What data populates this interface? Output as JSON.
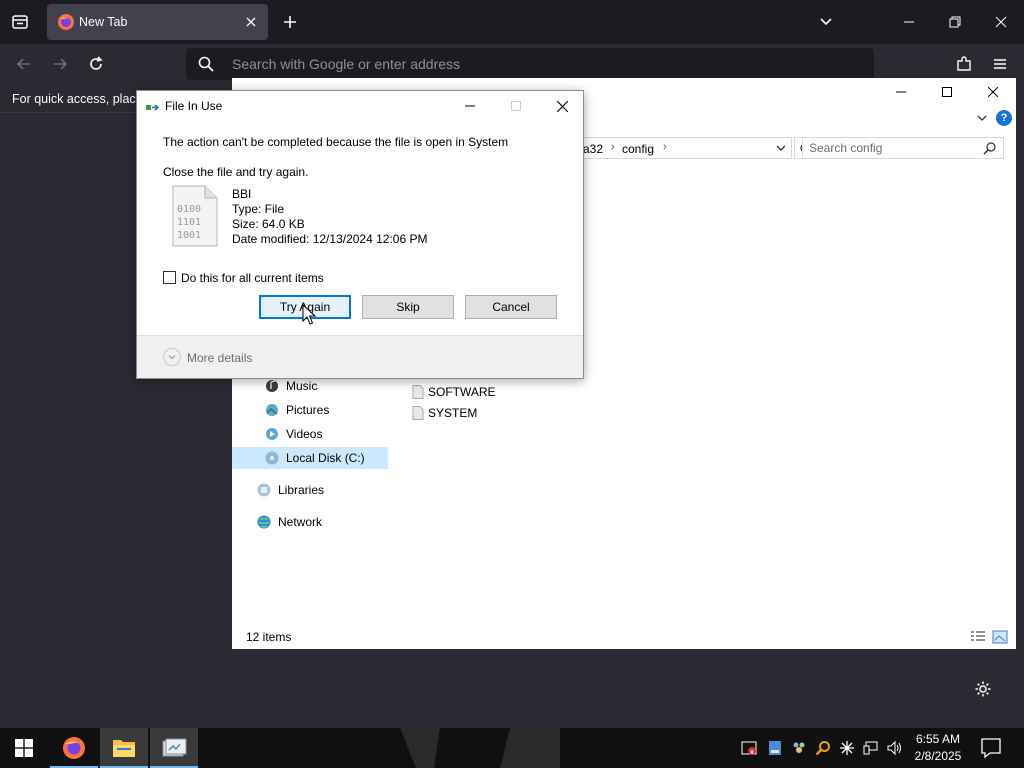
{
  "browser": {
    "tab_title": "New Tab",
    "url_placeholder": "Search with Google or enter address",
    "bookmarks_message": "For quick access, place"
  },
  "explorer": {
    "breadcrumb": [
      "a32",
      "config"
    ],
    "search_placeholder": "Search config",
    "nav_items": [
      {
        "label": "Music",
        "icon": "music-icon"
      },
      {
        "label": "Pictures",
        "icon": "pictures-icon"
      },
      {
        "label": "Videos",
        "icon": "videos-icon"
      },
      {
        "label": "Local Disk (C:)",
        "icon": "drive-icon",
        "selected": true
      },
      {
        "label": "Libraries",
        "icon": "libraries-icon"
      },
      {
        "label": "Network",
        "icon": "network-icon"
      }
    ],
    "files": [
      {
        "name": "SOFTWARE",
        "icon": "file-icon"
      },
      {
        "name": "SYSTEM",
        "icon": "file-icon"
      }
    ],
    "status": "12 items"
  },
  "dialog": {
    "title": "File In Use",
    "message": "The action can't be completed because the file is open in System",
    "instruction": "Close the file and try again.",
    "file": {
      "name": "BBI",
      "type": "Type: File",
      "size": "Size: 64.0 KB",
      "date": "Date modified: 12/13/2024 12:06 PM"
    },
    "checkbox_label": "Do this for all current items",
    "checkbox_checked": false,
    "buttons": {
      "try_again": "Try Again",
      "skip": "Skip",
      "cancel": "Cancel"
    },
    "more_details": "More details",
    "file_icon_lines": [
      "0100",
      "1101",
      "1001"
    ]
  },
  "taskbar": {
    "time": "6:55 AM",
    "date": "2/8/2025"
  },
  "colors": {
    "firefox_bg": "#2b2a33",
    "firefox_tabbar": "#1c1b22",
    "selection": "#cce8ff",
    "focus_blue": "#0078d7"
  }
}
